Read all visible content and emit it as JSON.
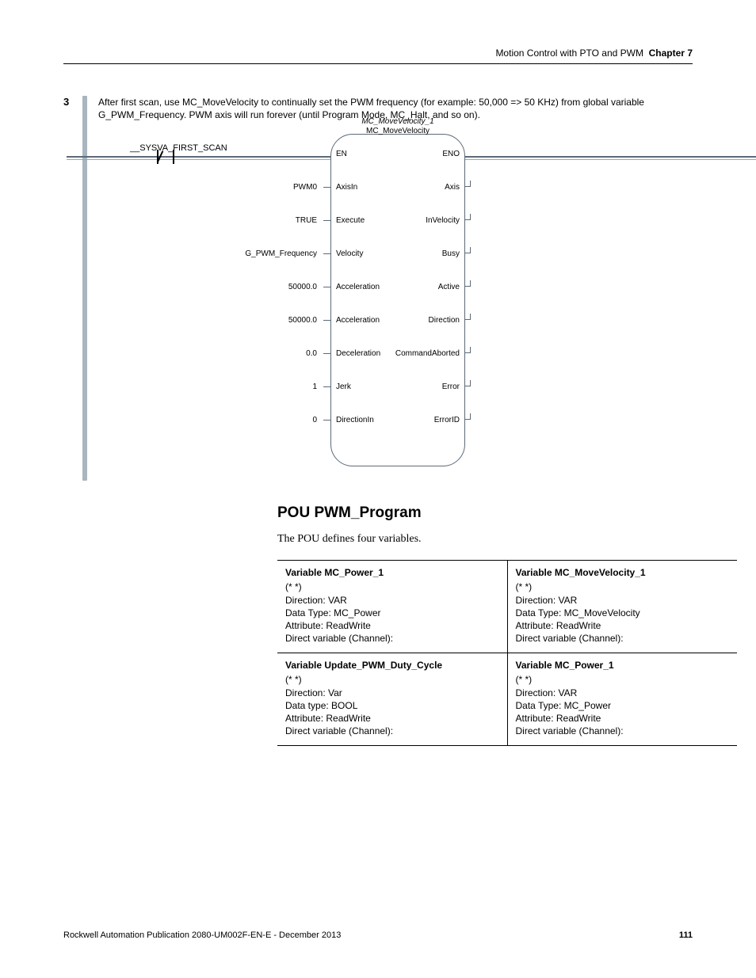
{
  "header": {
    "text": "Motion Control with PTO and PWM",
    "chapter_label": "Chapter 7"
  },
  "step": {
    "number": "3",
    "description": "After first scan, use MC_MoveVelocity to continually set the PWM frequency (for example: 50,000 => 50 KHz) from global variable G_PWM_Frequency. PWM axis will run forever (until Program Mode, MC_Halt, and so on)."
  },
  "contact": {
    "name": "__SYSVA_FIRST_SCAN"
  },
  "fb": {
    "instance": "MC_MoveVelocity_1",
    "type": "MC_MoveVelocity",
    "left_pins": [
      {
        "port": "EN",
        "val": ""
      },
      {
        "port": "AxisIn",
        "val": "PWM0"
      },
      {
        "port": "Execute",
        "val": "TRUE"
      },
      {
        "port": "Velocity",
        "val": "G_PWM_Frequency"
      },
      {
        "port": "Acceleration",
        "val": "50000.0"
      },
      {
        "port": "Acceleration",
        "val": "50000.0"
      },
      {
        "port": "Deceleration",
        "val": "0.0"
      },
      {
        "port": "Jerk",
        "val": "1"
      },
      {
        "port": "DirectionIn",
        "val": "0"
      }
    ],
    "right_pins": [
      {
        "port": "ENO"
      },
      {
        "port": "Axis"
      },
      {
        "port": "InVelocity"
      },
      {
        "port": "Busy"
      },
      {
        "port": "Active"
      },
      {
        "port": "Direction"
      },
      {
        "port": "CommandAborted"
      },
      {
        "port": "Error"
      },
      {
        "port": "ErrorID"
      }
    ]
  },
  "section": {
    "heading": "POU PWM_Program",
    "intro": "The POU defines four variables."
  },
  "vars": [
    {
      "name": "Variable MC_Power_1",
      "lines": [
        "(* *)",
        "Direction: VAR",
        "Data Type: MC_Power",
        "Attribute: ReadWrite",
        "Direct variable (Channel):"
      ]
    },
    {
      "name": "Variable MC_MoveVelocity_1",
      "lines": [
        "(* *)",
        "Direction: VAR",
        "Data Type: MC_MoveVelocity",
        "Attribute: ReadWrite",
        "Direct variable (Channel):"
      ]
    },
    {
      "name": "Variable Update_PWM_Duty_Cycle",
      "lines": [
        "(*  *)",
        "Direction: Var",
        "Data type: BOOL",
        "Attribute: ReadWrite",
        "Direct variable (Channel):"
      ]
    },
    {
      "name": "Variable MC_Power_1",
      "lines": [
        "(* *)",
        "Direction: VAR",
        "Data Type: MC_Power",
        "Attribute: ReadWrite",
        "Direct variable (Channel):"
      ]
    }
  ],
  "footer": {
    "pub": "Rockwell Automation Publication 2080-UM002F-EN-E - December 2013",
    "page": "111"
  }
}
